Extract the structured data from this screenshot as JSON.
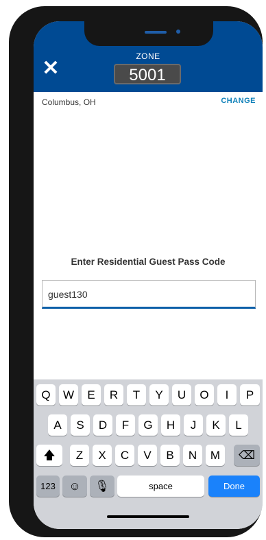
{
  "header": {
    "close_icon": "close-icon",
    "zone_label": "ZONE",
    "zone_number": "5001",
    "background": "#004a93"
  },
  "location": {
    "city": "Columbus, OH",
    "change_label": "CHANGE"
  },
  "form": {
    "prompt": "Enter Residential Guest Pass Code",
    "input_value": "guest130",
    "accent": "#0d5fa8"
  },
  "keyboard": {
    "row1": [
      "Q",
      "W",
      "E",
      "R",
      "T",
      "Y",
      "U",
      "O",
      "I",
      "P"
    ],
    "row2": [
      "A",
      "S",
      "D",
      "F",
      "G",
      "H",
      "J",
      "K",
      "L"
    ],
    "row3": [
      "Z",
      "X",
      "C",
      "V",
      "B",
      "N",
      "M"
    ],
    "shift_icon": "shift-icon",
    "delete_icon": "delete-icon",
    "numbers_label": "123",
    "emoji_icon": "emoji-icon",
    "mic_icon": "microphone-icon",
    "space_label": "space",
    "done_label": "Done",
    "done_color": "#1a82fb"
  }
}
